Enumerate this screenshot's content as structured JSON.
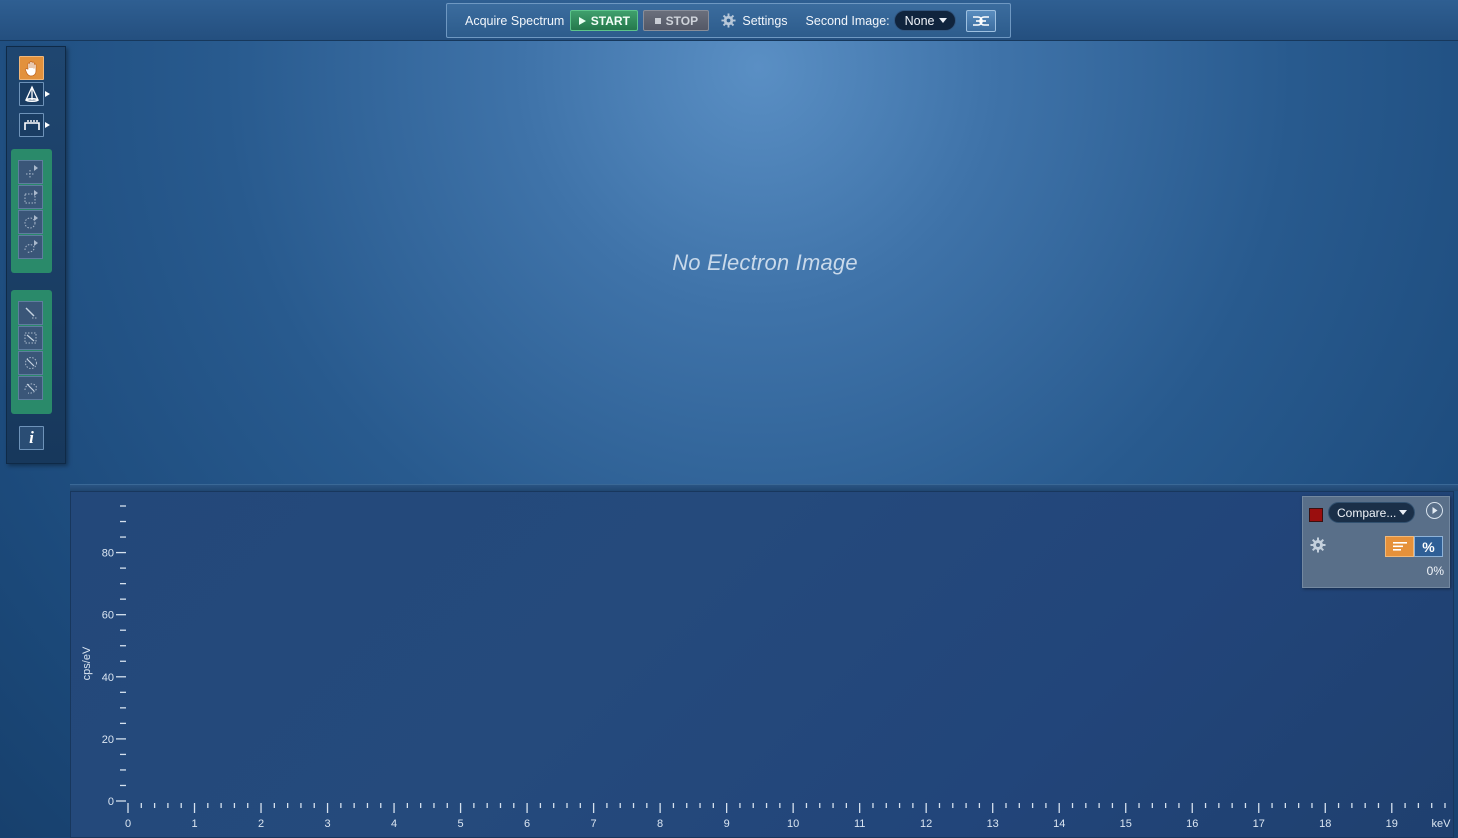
{
  "toolbar": {
    "acquire_label": "Acquire Spectrum",
    "start_label": "START",
    "stop_label": "STOP",
    "settings_label": "Settings",
    "second_image_label": "Second Image:",
    "second_image_value": "None"
  },
  "left_tools": {
    "pan": "hand-icon",
    "info_glyph": "i"
  },
  "image_area": {
    "placeholder": "No Electron Image"
  },
  "legend": {
    "compare_label": "Compare...",
    "series_color": "#9a0e0e",
    "percent_button": "%",
    "percent_value": "0%"
  },
  "chart_data": {
    "type": "line",
    "x_unit": "keV",
    "ylabel": "cps/eV",
    "xlim": [
      0,
      19.8
    ],
    "ylim": [
      0,
      95
    ],
    "x_ticks": [
      0,
      1,
      2,
      3,
      4,
      5,
      6,
      7,
      8,
      9,
      10,
      11,
      12,
      13,
      14,
      15,
      16,
      17,
      18,
      19
    ],
    "y_ticks": [
      0,
      20,
      40,
      60,
      80
    ],
    "series": []
  }
}
